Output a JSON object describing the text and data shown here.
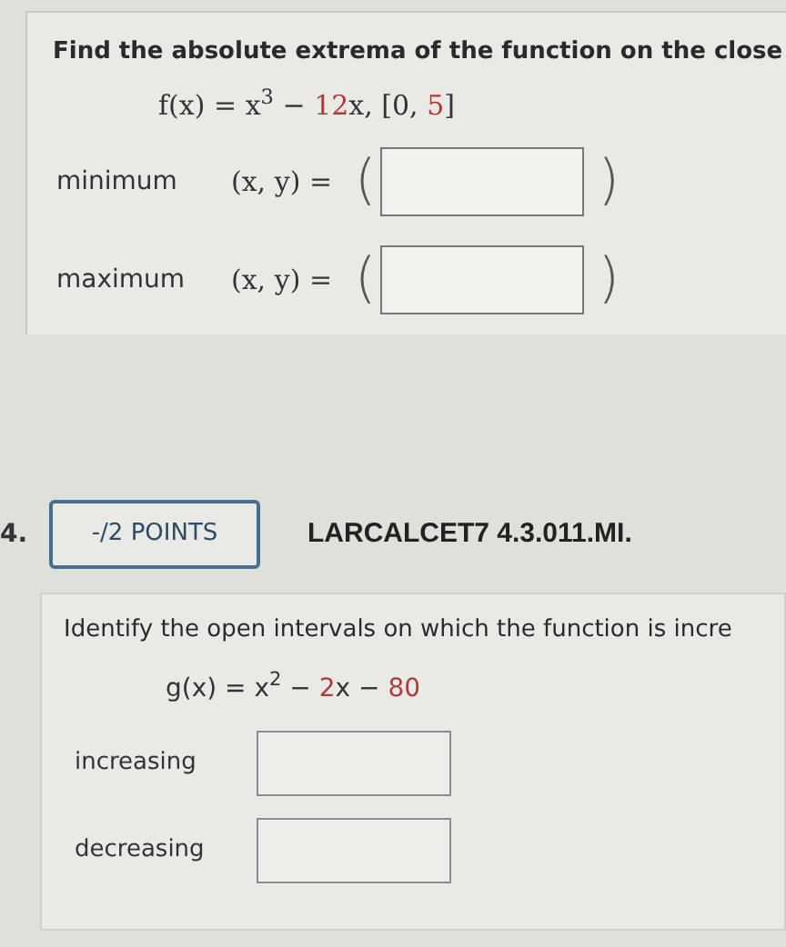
{
  "problem_1": {
    "prompt": "Find the absolute extrema of the function on the close",
    "equation": [
      {
        "text": "f(x) = x$^{3}$ − ",
        "given": false
      },
      {
        "text": "12",
        "given": true
      },
      {
        "text": "x,    [0, ",
        "given": false
      },
      {
        "text": "5",
        "given": true
      },
      {
        "text": "]",
        "given": false
      }
    ],
    "answers": [
      {
        "label": "minimum",
        "lhs": "(x, y) =",
        "open": "(",
        "close": ")"
      },
      {
        "label": "maximum",
        "lhs": "(x, y) =",
        "open": "(",
        "close": ")"
      }
    ]
  },
  "problem_2": {
    "number": "4.",
    "points": "-/2 POINTS",
    "source": "LARCALCET7 4.3.011.MI.",
    "prompt": "Identify the open intervals on which the function is incre",
    "equation": [
      {
        "text": "g(x) = x$^{2}$ − ",
        "given": false
      },
      {
        "text": "2",
        "given": true
      },
      {
        "text": "x − ",
        "given": false
      },
      {
        "text": "80",
        "given": true
      }
    ],
    "answers": [
      {
        "label": "increasing"
      },
      {
        "label": "decreasing"
      }
    ]
  }
}
